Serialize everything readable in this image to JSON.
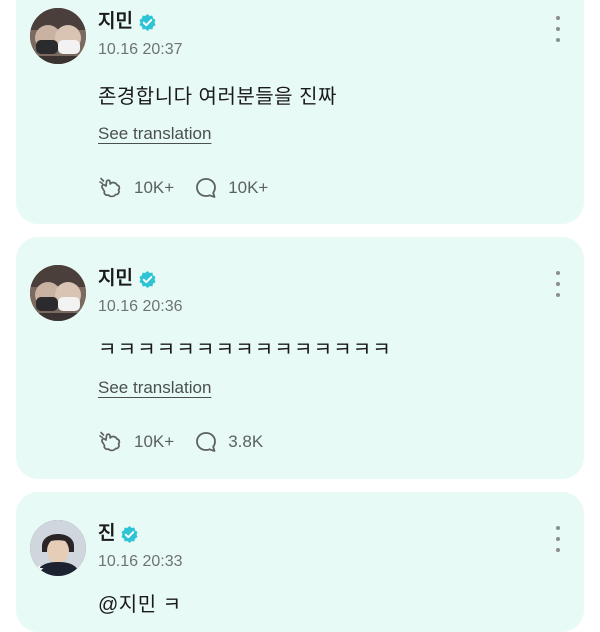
{
  "posts": [
    {
      "author": "지민",
      "verified": true,
      "timestamp": "10.16 20:37",
      "text": "존경합니다 여러분들을 진짜",
      "translate_label": "See translation",
      "reactions": "10K+",
      "comments": "10K+"
    },
    {
      "author": "지민",
      "verified": true,
      "timestamp": "10.16 20:36",
      "text": "ㅋㅋㅋㅋㅋㅋㅋㅋㅋㅋㅋㅋㅋㅋㅋ",
      "translate_label": "See translation",
      "reactions": "10K+",
      "comments": "3.8K"
    },
    {
      "author": "진",
      "verified": true,
      "timestamp": "10.16 20:33",
      "text": "@지민 ㅋ"
    }
  ],
  "colors": {
    "card_bg": "#e8faf6",
    "verified_badge": "#2ec4d6",
    "muted_text": "#6f7375",
    "icon_gray": "#5c6164"
  },
  "icons": {
    "more": "more-vertical-icon",
    "reaction": "reaction-icon",
    "comment": "comment-icon",
    "verified": "verified-badge-icon"
  }
}
